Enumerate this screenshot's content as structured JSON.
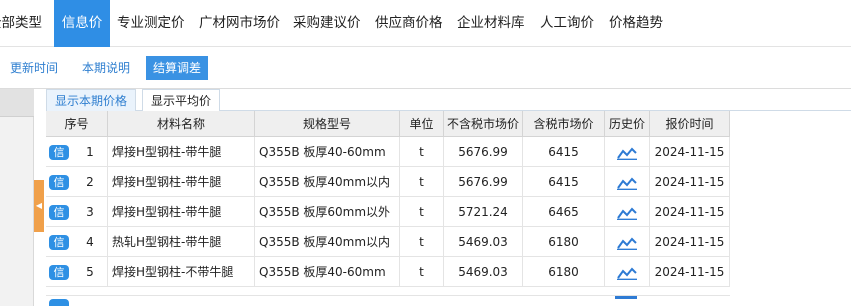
{
  "top_tabs": [
    "全部类型",
    "信息价",
    "专业测定价",
    "广材网市场价",
    "采购建议价",
    "供应商价格",
    "企业材料库",
    "人工询价",
    "价格趋势"
  ],
  "top_tab_active_index": 1,
  "sub_buttons": [
    "更新时间",
    "本期说明",
    "结算调差"
  ],
  "sub_button_active_index": 2,
  "view_tabs": [
    "显示本期价格",
    "显示平均价"
  ],
  "view_tab_active_index": 0,
  "table": {
    "columns": [
      "序号",
      "材料名称",
      "规格型号",
      "单位",
      "不含税市场价",
      "含税市场价",
      "历史价",
      "报价时间"
    ],
    "badge_label": "信",
    "rows": [
      {
        "seq": "1",
        "name": "焊接H型钢柱-带牛腿",
        "spec": "Q355B 板厚40-60mm",
        "unit": "t",
        "price_ex_tax": "5676.99",
        "price_inc_tax": "6415",
        "date": "2024-11-15"
      },
      {
        "seq": "2",
        "name": "焊接H型钢柱-带牛腿",
        "spec": "Q355B 板厚40mm以内",
        "unit": "t",
        "price_ex_tax": "5676.99",
        "price_inc_tax": "6415",
        "date": "2024-11-15"
      },
      {
        "seq": "3",
        "name": "焊接H型钢柱-带牛腿",
        "spec": "Q355B 板厚60mm以外",
        "unit": "t",
        "price_ex_tax": "5721.24",
        "price_inc_tax": "6465",
        "date": "2024-11-15"
      },
      {
        "seq": "4",
        "name": "热轧H型钢柱-带牛腿",
        "spec": "Q355B 板厚40mm以内",
        "unit": "t",
        "price_ex_tax": "5469.03",
        "price_inc_tax": "6180",
        "date": "2024-11-15"
      },
      {
        "seq": "5",
        "name": "焊接H型钢柱-不带牛腿",
        "spec": "Q355B 板厚40-60mm",
        "unit": "t",
        "price_ex_tax": "5469.03",
        "price_inc_tax": "6180",
        "date": "2024-11-15"
      }
    ]
  },
  "icons": {
    "trend": "trend-chart-icon",
    "collapse": "collapse-arrow-icon"
  },
  "colors": {
    "accent": "#2f8ee5",
    "badge": "#2e90e4",
    "handle": "#f0a04a",
    "link": "#2f7fd0"
  }
}
